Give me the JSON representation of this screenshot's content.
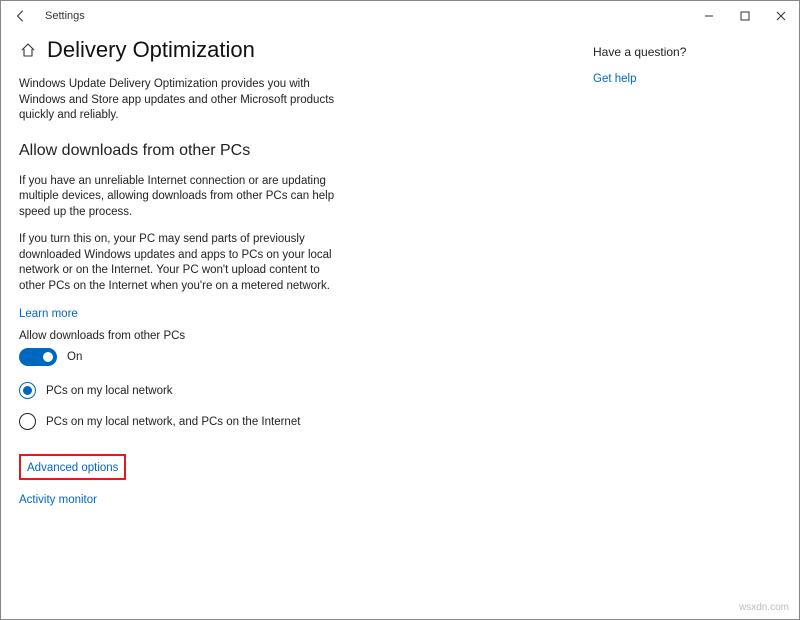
{
  "window": {
    "app_title": "Settings"
  },
  "page": {
    "title": "Delivery Optimization",
    "description": "Windows Update Delivery Optimization provides you with Windows and Store app updates and other Microsoft products quickly and reliably."
  },
  "section": {
    "title": "Allow downloads from other PCs",
    "para1": "If you have an unreliable Internet connection or are updating multiple devices, allowing downloads from other PCs can help speed up the process.",
    "para2": "If you turn this on, your PC may send parts of previously downloaded Windows updates and apps to PCs on your local network or on the Internet. Your PC won't upload content to other PCs on the Internet when you're on a metered network.",
    "learn_more": "Learn more",
    "toggle_label": "Allow downloads from other PCs",
    "toggle_state": "On",
    "radio_options": [
      {
        "label": "PCs on my local network",
        "selected": true
      },
      {
        "label": "PCs on my local network, and PCs on the Internet",
        "selected": false
      }
    ]
  },
  "links": {
    "advanced_options": "Advanced options",
    "activity_monitor": "Activity monitor"
  },
  "side": {
    "question": "Have a question?",
    "get_help": "Get help"
  },
  "watermark": "wsxdn.com"
}
